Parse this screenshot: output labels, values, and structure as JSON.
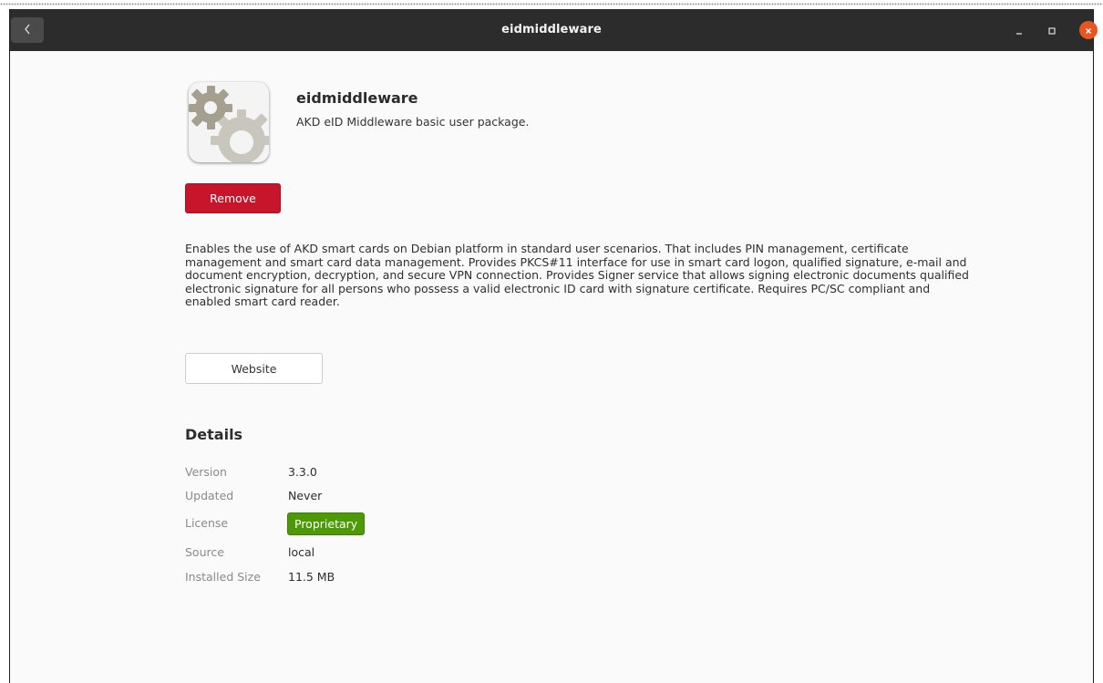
{
  "window": {
    "title": "eidmiddleware"
  },
  "app": {
    "name": "eidmiddleware",
    "summary": "AKD eID Middleware basic user package.",
    "icon": "gears-icon",
    "remove_label": "Remove",
    "description": "Enables the use of AKD smart cards on Debian platform in standard user scenarios.  That includes PIN management, certificate management and smart card data management. Provides PKCS#11 interface for use in smart card logon, qualified signature, e-mail  and document encryption, decryption, and secure VPN connection. Provides Signer service that allows signing electronic documents qualified electronic signature for all persons  who possess a valid electronic ID card with signature certificate. Requires PC/SC compliant and enabled smart card reader.",
    "website_label": "Website"
  },
  "details": {
    "title": "Details",
    "rows": [
      {
        "key": "Version",
        "value": "3.3.0"
      },
      {
        "key": "Updated",
        "value": "Never"
      },
      {
        "key": "License",
        "value": "Proprietary"
      },
      {
        "key": "Source",
        "value": "local"
      },
      {
        "key": "Installed Size",
        "value": "11.5 MB"
      }
    ]
  },
  "colors": {
    "titlebar": "#2c2c2c",
    "remove_button": "#c7162b",
    "license_badge": "#4e9a06",
    "close_button": "#e95420"
  }
}
